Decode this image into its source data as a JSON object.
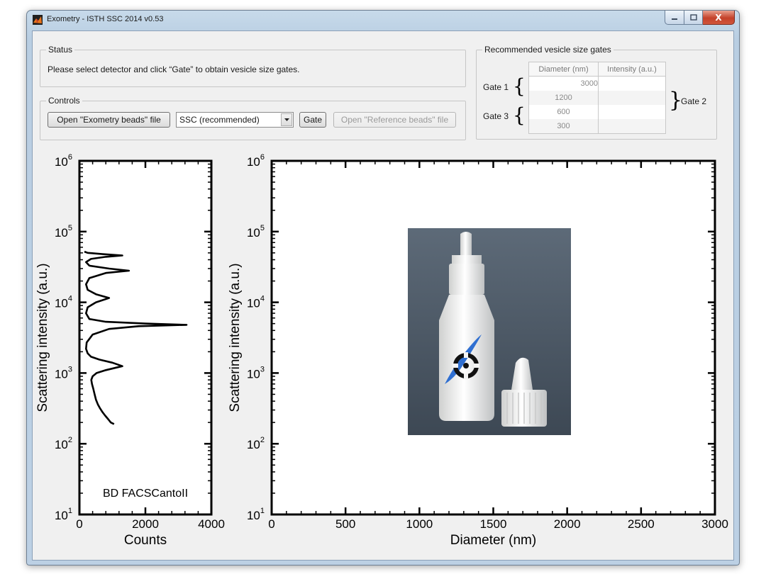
{
  "window": {
    "title": "Exometry - ISTH SSC 2014 v0.53",
    "close_glyph": "X"
  },
  "status": {
    "legend": "Status",
    "message": "Please select detector and click “Gate” to obtain vesicle size gates."
  },
  "controls": {
    "legend": "Controls",
    "open_exometry_label": "Open \"Exometry beads\" file",
    "detector_selected": "SSC (recommended)",
    "gate_label": "Gate",
    "open_reference_label": "Open \"Reference beads\" file"
  },
  "gates": {
    "legend": "Recommended vesicle size gates",
    "columns": [
      "Diameter (nm)",
      "Intensity (a.u.)"
    ],
    "rows": [
      {
        "diameter": "3000",
        "intensity": ""
      },
      {
        "diameter": "1200",
        "intensity": ""
      },
      {
        "diameter": "600",
        "intensity": ""
      },
      {
        "diameter": "300",
        "intensity": ""
      }
    ],
    "gate1_label": "Gate 1",
    "gate2_label": "Gate 2",
    "gate3_label": "Gate 3"
  },
  "chart_data": [
    {
      "type": "line",
      "xlabel": "Counts",
      "ylabel": "Scattering intensity (a.u.)",
      "xlim": [
        0,
        4000
      ],
      "ylim_log10": [
        1,
        6
      ],
      "yscale": "log",
      "x_ticks": [
        "0",
        "2000",
        "4000"
      ],
      "y_tick_exponents": [
        "1",
        "2",
        "3",
        "4",
        "5",
        "6"
      ],
      "y_tick_base": "10",
      "annotation": "BD FACSCantoII",
      "series": [
        {
          "x": [
            1050,
            950,
            880,
            780,
            700,
            620,
            560,
            500,
            460,
            420,
            380,
            360,
            400,
            520,
            800,
            1300,
            1000,
            600,
            350,
            250,
            200,
            220,
            400,
            900,
            1800,
            3250,
            2000,
            800,
            300,
            200,
            250,
            500,
            900,
            500,
            250,
            200,
            300,
            800,
            1500,
            900,
            300,
            200,
            350,
            800,
            1300,
            700,
            250,
            150
          ],
          "y": [
            190,
            200,
            220,
            250,
            280,
            320,
            360,
            420,
            500,
            600,
            700,
            800,
            900,
            1000,
            1100,
            1250,
            1400,
            1550,
            1700,
            1900,
            2200,
            2700,
            3500,
            4200,
            4600,
            4800,
            5000,
            5300,
            5800,
            7000,
            8500,
            10000,
            11500,
            13000,
            15000,
            18000,
            22000,
            26000,
            28000,
            30000,
            33000,
            37000,
            41000,
            44000,
            46000,
            48000,
            50000,
            52000
          ]
        }
      ]
    },
    {
      "type": "scatter",
      "xlabel": "Diameter (nm)",
      "ylabel": "Scattering intensity (a.u.)",
      "xlim": [
        0,
        3000
      ],
      "ylim_log10": [
        1,
        6
      ],
      "yscale": "log",
      "x_ticks": [
        "0",
        "500",
        "1000",
        "1500",
        "2000",
        "2500",
        "3000"
      ],
      "y_tick_exponents": [
        "1",
        "2",
        "3",
        "4",
        "5",
        "6"
      ],
      "y_tick_base": "10",
      "series": []
    }
  ],
  "photo": {
    "description_icon": "exometry-beads-bottle-photo",
    "colors": {
      "bg_top": "#5d6a78",
      "bg_bottom": "#3d4854",
      "bottle": "#f2f2f0",
      "logo_blue": "#2f6fd1"
    }
  },
  "colors": {
    "window_frame": "#b9cee2",
    "client_bg": "#f0f0f0",
    "close_button": "#c4412a"
  }
}
